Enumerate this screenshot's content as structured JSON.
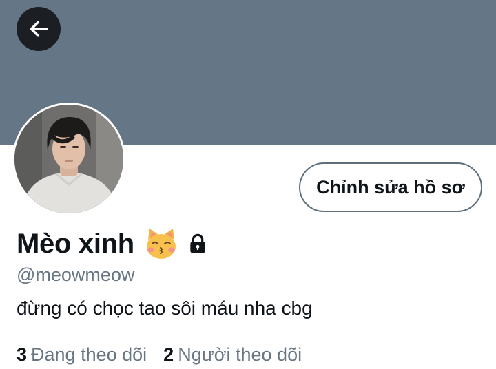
{
  "header": {
    "back_icon": "arrow-left-icon",
    "banner_color": "#657786"
  },
  "profile": {
    "display_name": "Mèo xinh",
    "name_emoji": "kissing-cat-emoji",
    "protected_icon": "lock-icon",
    "handle": "@meowmeow",
    "bio": "đừng có chọc tao sôi máu nha cbg",
    "edit_button_label": "Chỉnh sửa hồ sơ"
  },
  "stats": {
    "following_count": "3",
    "following_label": "Đang theo dõi",
    "followers_count": "2",
    "followers_label": "Người theo dõi"
  },
  "colors": {
    "text_primary": "#0f1419",
    "text_secondary": "#687684",
    "button_border": "#5e6f7b"
  }
}
